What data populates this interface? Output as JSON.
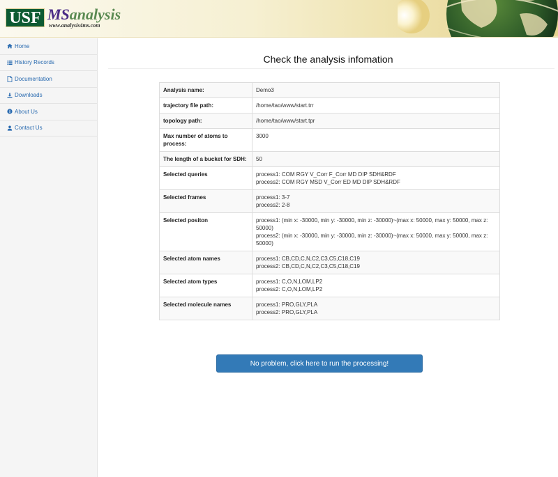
{
  "header": {
    "logo_usf": "USF",
    "logo_ms": "MS",
    "logo_analysis": "analysis",
    "logo_url": "www.analysis4ms.com"
  },
  "sidebar": {
    "items": [
      {
        "label": "Home",
        "icon": "home-icon"
      },
      {
        "label": "History Records",
        "icon": "list-icon"
      },
      {
        "label": "Documentation",
        "icon": "file-icon"
      },
      {
        "label": "Downloads",
        "icon": "download-icon"
      },
      {
        "label": "About Us",
        "icon": "info-icon"
      },
      {
        "label": "Contact Us",
        "icon": "user-icon"
      }
    ]
  },
  "main": {
    "title": "Check the analysis infomation",
    "rows": [
      {
        "key": "Analysis name:",
        "lines": [
          "Demo3"
        ]
      },
      {
        "key": "trajectory file path:",
        "lines": [
          "/home/tao/www/start.trr"
        ]
      },
      {
        "key": "topology path:",
        "lines": [
          "/home/tao/www/start.tpr"
        ]
      },
      {
        "key": "Max number of atoms to process:",
        "lines": [
          "3000"
        ]
      },
      {
        "key": "The length of a bucket for SDH:",
        "lines": [
          "50"
        ]
      },
      {
        "key": "Selected queries",
        "lines": [
          "process1: COM RGY V_Corr F_Corr MD DIP SDH&RDF",
          "process2: COM RGY MSD V_Corr ED MD DIP SDH&RDF"
        ]
      },
      {
        "key": "Selected frames",
        "lines": [
          "process1: 3-7",
          "process2: 2-8"
        ]
      },
      {
        "key": "Selected positon",
        "lines": [
          "process1: (min x: -30000, min y: -30000, min z: -30000)~(max x: 50000, max y: 50000, max z: 50000)",
          "process2: (min x: -30000, min y: -30000, min z: -30000)~(max x: 50000, max y: 50000, max z: 50000)"
        ]
      },
      {
        "key": "Selected atom names",
        "lines": [
          "process1: CB,CD,C,N,C2,C3,C5,C18,C19",
          "process2: CB,CD,C,N,C2,C3,C5,C18,C19"
        ]
      },
      {
        "key": "Selected atom types",
        "lines": [
          "process1: C,O,N,LOM,LP2",
          "process2: C,O,N,LOM,LP2"
        ]
      },
      {
        "key": "Selected molecule names",
        "lines": [
          "process1: PRO,GLY,PLA",
          "process2: PRO,GLY,PLA"
        ]
      }
    ],
    "run_button": "No problem, click here to run the processing!"
  },
  "colors": {
    "link": "#2a6bb0",
    "button": "#337ab7",
    "logo_green": "#0c5a32",
    "logo_purple": "#4a2a86"
  }
}
